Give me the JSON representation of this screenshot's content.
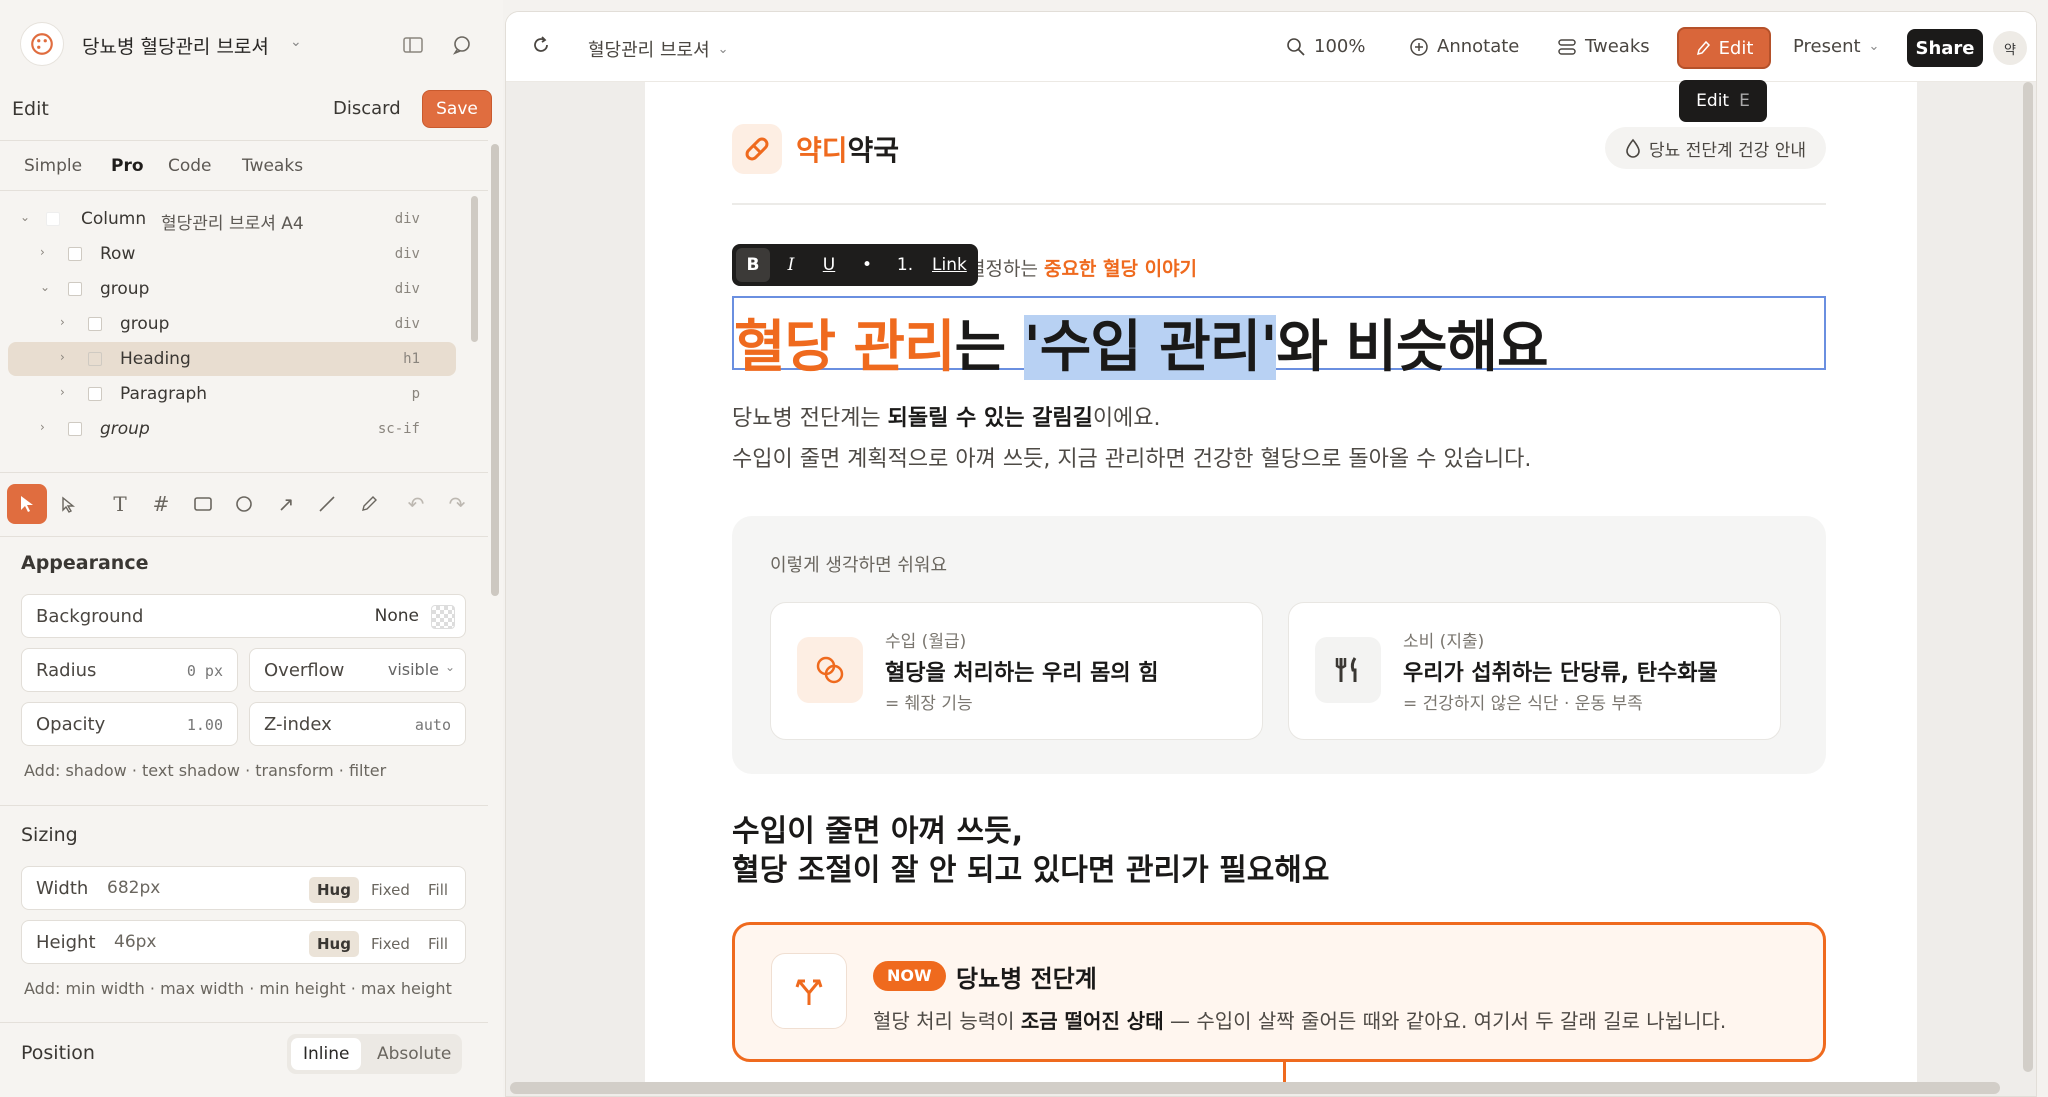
{
  "app": {
    "doc_title": "당뇨병 혈당관리 브로셔",
    "edit_label": "Edit",
    "discard": "Discard",
    "save": "Save",
    "accent": "#e06d3f"
  },
  "panel_tabs": [
    "Simple",
    "Pro",
    "Code",
    "Tweaks"
  ],
  "layer_tree": [
    {
      "name": "Column",
      "sub": "혈당관리 브로셔 A4",
      "tag": "div"
    },
    {
      "name": "Row",
      "tag": "div"
    },
    {
      "name": "group",
      "tag": "div"
    },
    {
      "name": "group",
      "tag": "div"
    },
    {
      "name": "Heading",
      "tag": "h1"
    },
    {
      "name": "Paragraph",
      "tag": "p"
    },
    {
      "name": "group",
      "tag": "sc-if"
    }
  ],
  "appearance": {
    "title": "Appearance",
    "background_label": "Background",
    "background_value": "None",
    "radius_label": "Radius",
    "radius_value": "0 px",
    "overflow_label": "Overflow",
    "overflow_value": "visible",
    "opacity_label": "Opacity",
    "opacity_value": "1.00",
    "zindex_label": "Z-index",
    "zindex_value": "auto",
    "add_line": "Add: shadow · text shadow · transform · filter"
  },
  "sizing": {
    "title": "Sizing",
    "width_label": "Width",
    "width_value": "682px",
    "height_label": "Height",
    "height_value": "46px",
    "modes": [
      "Hug",
      "Fixed",
      "Fill"
    ],
    "add_line": "Add: min width · max width · min height · max height"
  },
  "position": {
    "title": "Position",
    "options": [
      "Inline",
      "Absolute"
    ]
  },
  "topbar": {
    "doc_name": "혈당관리 브로셔",
    "zoom": "100%",
    "annotate": "Annotate",
    "tweaks": "Tweaks",
    "edit": "Edit",
    "present": "Present",
    "share": "Share",
    "avatar": "약",
    "tooltip_label": "Edit",
    "tooltip_key": "E"
  },
  "page": {
    "brand_a": "약디",
    "brand_b": "약국",
    "pill": "당뇨 전단계 건강 안내",
    "eyebrow_plain": "결정하는",
    "eyebrow_accent": "중요한 혈당 이야기",
    "format_buttons": [
      "B",
      "I",
      "U",
      "•",
      "1.",
      "Link"
    ],
    "heading_accent": "혈당 관리",
    "heading_mid": "는 ",
    "heading_selected": "'수입 관리'",
    "heading_end": "와 비슷해요",
    "para_1_a": "당뇨병 전단계는 ",
    "para_1_b": "되돌릴 수 있는 갈림길",
    "para_1_c": "이에요.",
    "para_2": "수입이 줄면 계획적으로 아껴 쓰듯, 지금 관리하면 건강한 혈당으로 돌아올 수 있습니다.",
    "think_title": "이렇게 생각하면 쉬워요",
    "cards": [
      {
        "kicker": "수입 (월급)",
        "title": "혈당을 처리하는 우리 몸의 힘",
        "sub": "= 췌장 기능"
      },
      {
        "kicker": "소비 (지출)",
        "title": "우리가 섭취하는 단당류, 탄수화물",
        "sub": "= 건강하지 않은 식단 · 운동 부족"
      }
    ],
    "sub_heading_1": "수입이 줄면 아껴 쓰듯,",
    "sub_heading_2": "혈당 조절이 잘 안 되고 있다면 관리가 필요해요",
    "now_badge": "NOW",
    "now_title": "당뇨병 전단계",
    "now_desc_a": "혈당 처리 능력이 ",
    "now_desc_b": "조금 떨어진 상태",
    "now_desc_c": " — 수입이 살짝 줄어든 때와 같아요. 여기서 두 갈래 길로 나뉩니다.",
    "accent": "#ef6a1e"
  }
}
